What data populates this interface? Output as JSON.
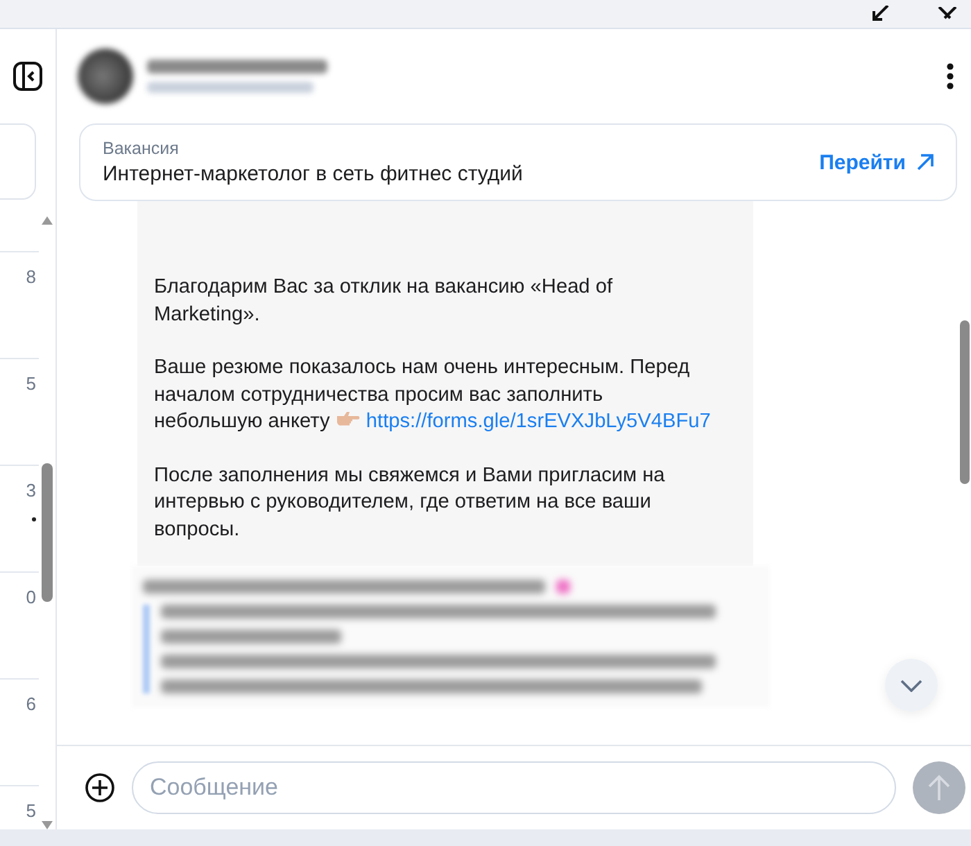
{
  "sidebar": {
    "items": [
      {
        "time": "8",
        "unread": false
      },
      {
        "time": "5",
        "unread": false
      },
      {
        "time": "3",
        "unread": true
      },
      {
        "time": "0",
        "unread": false
      },
      {
        "time": "6",
        "unread": false
      },
      {
        "time": "5",
        "unread": false
      }
    ]
  },
  "vacancy": {
    "label": "Вакансия",
    "title": "Интернет-маркетолог в сеть фитнес студий",
    "action": "Перейти"
  },
  "message": {
    "paragraphs": [
      {
        "text": "Благодарим Вас за отклик на вакансию «Head of Marketing»."
      },
      {
        "text": "Ваше резюме показалось нам очень интересным. Перед началом сотрудничества просим вас заполнить небольшую анкету",
        "link": "https://forms.gle/1srEVXJbLy5V4BFu7"
      },
      {
        "text": "После заполнения мы свяжемся и Вами пригласим на интервью с руководителем, где ответим на все ваши вопросы."
      }
    ]
  },
  "composer": {
    "placeholder": "Сообщение"
  }
}
